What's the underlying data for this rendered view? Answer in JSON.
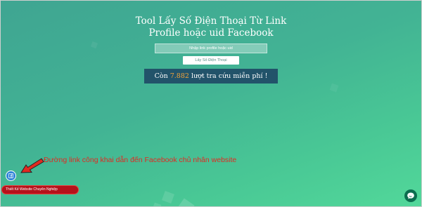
{
  "header": {
    "title_line1": "Tool Lấy Số Điện Thoại Từ Link",
    "title_line2": "Profile hoặc uid Facebook"
  },
  "form": {
    "input_placeholder": "Nhập link profile hoặc uid",
    "input_value": "",
    "button_label": "Lấy Số Điện Thoại"
  },
  "counter": {
    "prefix": "Còn",
    "count": "7.882",
    "suffix": "lượt tra cứu miễn phí !"
  },
  "annotation": {
    "text": "Đường link công khai dẫn đến Facebook chủ nhân website",
    "color": "#e02a21"
  },
  "floating": {
    "facebook_icon": "facebook-icon",
    "design_label": "Thiết Kế Website Chuyên Nghiệp",
    "chat_icon": "chat-bubble-icon"
  },
  "colors": {
    "counter_bg": "#22536a",
    "count_highlight": "#f2a33a",
    "facebook_blue": "#2f84d8",
    "design_bar_red": "#b5121b",
    "chat_green": "#0b6e4f"
  }
}
